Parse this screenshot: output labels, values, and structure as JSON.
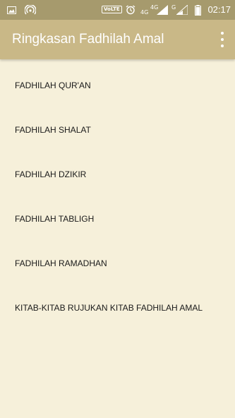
{
  "status_bar": {
    "left_icons": [
      "image-icon",
      "hotspot-icon"
    ],
    "volte": "VoLTE",
    "net1": "4G",
    "net2": "4G",
    "net3": "G",
    "time": "02:17"
  },
  "app_bar": {
    "title": "Ringkasan Fadhilah Amal",
    "overflow_icon": "more-vert-icon"
  },
  "menu": [
    {
      "label": "FADHILAH QUR'AN"
    },
    {
      "label": "FADHILAH SHALAT"
    },
    {
      "label": "FADHILAH DZIKIR"
    },
    {
      "label": "FADHILAH TABLIGH"
    },
    {
      "label": "FADHILAH RAMADHAN"
    },
    {
      "label": "KITAB-KITAB RUJUKAN KITAB FADHILAH AMAL"
    }
  ],
  "colors": {
    "status_bar": "#a69a6d",
    "app_bar": "#c9b887",
    "background": "#f6f0da"
  }
}
